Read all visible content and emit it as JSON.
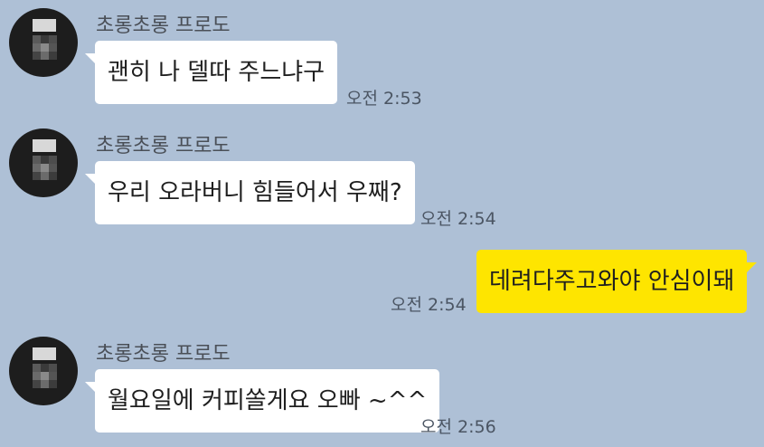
{
  "messages": [
    {
      "sender": "초롱초롱 프로도",
      "text": "괜히  나 델따 주느냐구",
      "time": "오전 2:53",
      "direction": "incoming"
    },
    {
      "sender": "초롱초롱 프로도",
      "text": "우리 오라버니 힘들어서 우째?",
      "time": "오전 2:54",
      "direction": "incoming"
    },
    {
      "sender": "",
      "text": "데려다주고와야 안심이돼",
      "time": "오전 2:54",
      "direction": "outgoing"
    },
    {
      "sender": "초롱초롱 프로도",
      "text": "월요일에 커피쏠게요 오빠 ~^^",
      "time": "오전 2:56",
      "direction": "incoming"
    }
  ],
  "colors": {
    "background": "#aec0d6",
    "incoming_bubble": "#ffffff",
    "outgoing_bubble": "#fee500"
  },
  "icons": {
    "avatar": "mosaic-profile-avatar"
  }
}
